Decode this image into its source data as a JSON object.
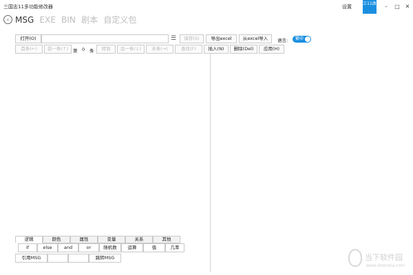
{
  "window": {
    "title": "三国志11多功能修改器",
    "settings_label": "设置",
    "logo_text": "三11改",
    "minimize_glyph": "–",
    "maximize_glyph": "□",
    "close_glyph": "✕"
  },
  "back_glyph": "‹",
  "tabs": [
    "MSG",
    "EXE",
    "BIN",
    "剧本",
    "自定义包"
  ],
  "toolbar": {
    "open_label": "打开(O)",
    "list_glyph": "☰",
    "save_label": "保存(S)",
    "export_label": "导出excel",
    "import_label": "从excel导入",
    "lang_label": "语言:",
    "lang_value": "繁中"
  },
  "nav": {
    "first": "首条(←)",
    "prev": "前一条(↑)",
    "index_prefix": "第",
    "index_value": "0",
    "index_suffix": "条",
    "goto": "转到",
    "next": "后一条(↓)",
    "last": "末条(→)",
    "find": "查找(F)",
    "insert": "插入(N)",
    "delete": "删除(Del)",
    "apply": "应用(H)"
  },
  "bottom": {
    "cat_tabs": [
      "逻辑",
      "颜色",
      "属性",
      "变量",
      "关系",
      "其他"
    ],
    "row1": [
      "if",
      "else",
      "and",
      "or",
      "随机数",
      "运算",
      "值",
      "几率"
    ],
    "row2": [
      "引用MSG",
      "",
      "",
      "跳转MSG"
    ]
  },
  "watermark": {
    "name": "当下软件园",
    "url": "www.downxia.com"
  }
}
